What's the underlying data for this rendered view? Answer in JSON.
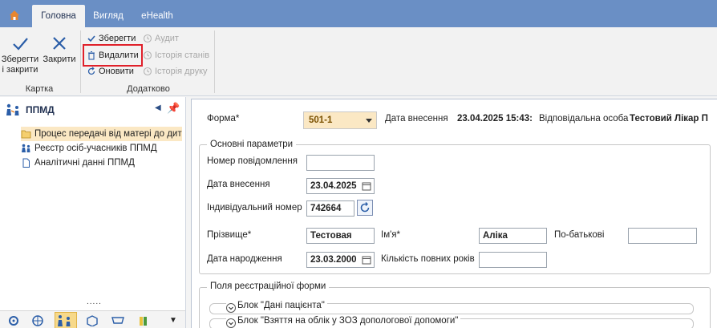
{
  "tabs": {
    "home": "home",
    "items": [
      "Головна",
      "Вигляд",
      "eHealth"
    ]
  },
  "ribbon": {
    "save_close": "Зберегти\nі закрити",
    "close": "Закрити",
    "group_card": "Картка",
    "save": "Зберегти",
    "delete": "Видалити",
    "refresh": "Оновити",
    "audit": "Аудит",
    "state_history": "Історія станів",
    "print_history": "Історія друку",
    "group_extra": "Додатково"
  },
  "left_panel": {
    "title": "ППМД",
    "items": [
      "Процес передачі від матері до дитини",
      "Реєстр осіб-учасників ППМД",
      "Аналітичні данні ППМД"
    ],
    "dots": "....."
  },
  "form": {
    "form_label": "Форма*",
    "form_value": "501-1",
    "entry_date_label": "Дата внесення",
    "entry_datetime": "23.04.2025 15:43:",
    "responsible_label": "Відповідальна особа",
    "responsible_value": "Тестовий Лікар П",
    "main_params": "Основні параметри",
    "msg_number_label": "Номер повідомлення",
    "msg_number_value": "",
    "entry_date_label2": "Дата внесення",
    "entry_date_value": "23.04.2025",
    "individual_number_label": "Індивідуальний номер",
    "individual_number_value": "742664",
    "surname_label": "Прізвище*",
    "surname_value": "Тестовая",
    "name_label": "Ім'я*",
    "name_value": "Аліка",
    "patronymic_label": "По-батькові",
    "patronymic_value": "",
    "birth_date_label": "Дата народження",
    "birth_date_value": "23.03.2000",
    "full_years_label": "Кількість повних років",
    "full_years_value": "",
    "reg_fields": "Поля реєстраційної форми",
    "block1": "Блок \"Дані пацієнта\"",
    "block2": "Блок \"Взяття на облік у ЗОЗ допологової допомоги\""
  },
  "colors": {
    "tabbar": "#6a8fc5",
    "selection": "#fbe8c4",
    "highlight_box": "#e0202a"
  }
}
